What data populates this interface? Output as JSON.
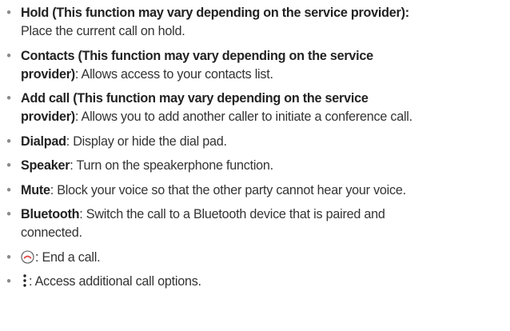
{
  "bullet_glyph": "•",
  "items": [
    {
      "term_line1": "Hold (This function may vary depending on the service provider)",
      "sep": ":",
      "desc_line1": "",
      "desc_line2": "Place the current call on hold."
    },
    {
      "term_line1": "Contacts (This function may vary depending on the service",
      "term_line2": "provider)",
      "sep": ":",
      "desc_line2": " Allows access to your contacts list."
    },
    {
      "term_line1": "Add call (This function may vary depending on the service",
      "term_line2": "provider)",
      "sep": ":",
      "desc_line2": " Allows you to add another caller to initiate a conference call."
    },
    {
      "term": "Dialpad",
      "desc": ": Display or hide the dial pad."
    },
    {
      "term": "Speaker",
      "desc": ": Turn on the speakerphone function."
    },
    {
      "term": "Mute",
      "desc": ": Block your voice so that the other party cannot hear your voice."
    },
    {
      "term": "Bluetooth",
      "desc_line1": ": Switch the call to a Bluetooth device that is paired and",
      "desc_line2": "connected."
    },
    {
      "icon": "end-call-icon",
      "desc": ": End a call."
    },
    {
      "icon": "more-options-icon",
      "desc": ": Access additional call options."
    }
  ],
  "colors": {
    "text": "#222222",
    "bullet": "#8a8a8a",
    "end_call_icon": "#e25050"
  }
}
